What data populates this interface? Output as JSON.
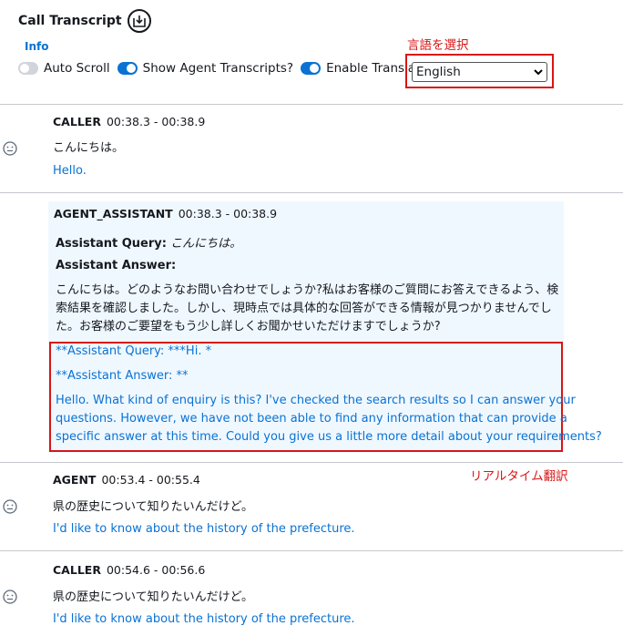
{
  "header": {
    "title": "Call Transcript",
    "info": "Info"
  },
  "controls": {
    "auto_scroll": {
      "label": "Auto Scroll",
      "on": false
    },
    "show_agent": {
      "label": "Show Agent Transcripts?",
      "on": true
    },
    "translation": {
      "label": "Enable Translation",
      "on": true
    },
    "language": "English"
  },
  "annotations": {
    "select_language": "言語を選択",
    "realtime": "リアルタイム翻訳"
  },
  "colors": {
    "accent": "#0972d3",
    "highlight": "#d91515",
    "panel": "#f0f8ff"
  },
  "entries": [
    {
      "speaker": "CALLER",
      "time": "00:38.3 - 00:38.9",
      "text": "こんにちは。",
      "translation": "Hello."
    },
    {
      "speaker": "AGENT_ASSISTANT",
      "time": "00:38.3 - 00:38.9",
      "query_label": "Assistant Query:",
      "query": "こんにちは。",
      "answer_label": "Assistant Answer:",
      "answer_lines": [
        "こんにちは。どのようなお問い合わせでしょうか?私はお客様のご質問にお答えできるよう、検",
        "索結果を確認しました。しかし、現時点では具体的な回答ができる情報が見つかりませんでし",
        "た。お客様のご要望をもう少し詳しくお聞かせいただけますでしょうか?"
      ],
      "trans_query": "**Assistant Query: ***Hi. *",
      "trans_answer_label": "**Assistant Answer: **",
      "trans_answer_lines": [
        "Hello. What kind of enquiry is this? I've checked the search results so I can answer your",
        "questions. However, we have not been able to find any information that can provide a",
        "specific answer at this time. Could you give us a little more detail about your requirements?"
      ]
    },
    {
      "speaker": "AGENT",
      "time": "00:53.4 - 00:55.4",
      "text": "県の歴史について知りたいんだけど。",
      "translation": "I'd like to know about the history of the prefecture."
    },
    {
      "speaker": "CALLER",
      "time": "00:54.6 - 00:56.6",
      "text": "県の歴史について知りたいんだけど。",
      "translation": "I'd like to know about the history of the prefecture."
    }
  ]
}
